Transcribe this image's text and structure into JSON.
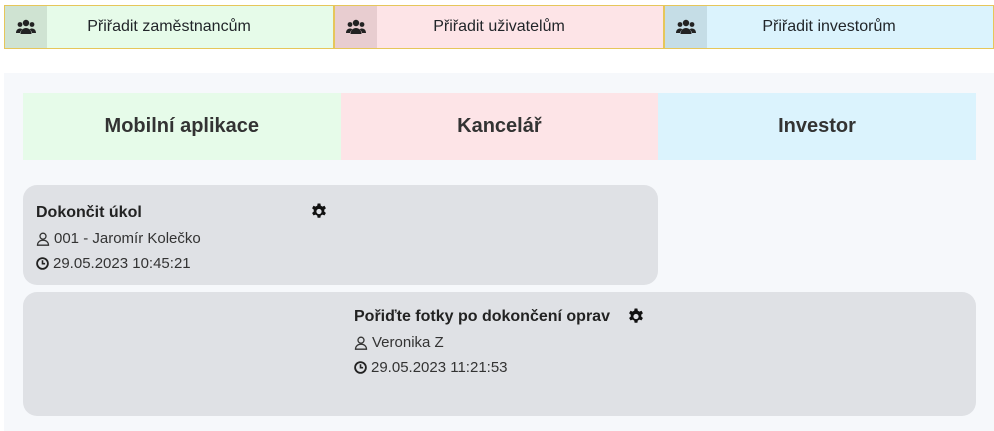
{
  "assign_buttons": [
    {
      "label": "Přiřadit zaměstnancům",
      "icon": "users-icon",
      "color": "#e6fbe9"
    },
    {
      "label": "Přiřadit uživatelům",
      "icon": "users-icon",
      "color": "#fde4e7"
    },
    {
      "label": "Přiřadit investorům",
      "icon": "users-icon",
      "color": "#dbf3fd"
    }
  ],
  "columns": [
    {
      "title": "Mobilní aplikace",
      "color": "#e6fbe9"
    },
    {
      "title": "Kancelář",
      "color": "#fde4e7"
    },
    {
      "title": "Investor",
      "color": "#dbf3fd"
    }
  ],
  "tasks": [
    {
      "title": "Dokončit úkol",
      "assignee": "001 - Jaromír Kolečko",
      "datetime": "29.05.2023 10:45:21",
      "user_icon": "user-outline-icon",
      "clock_icon": "clock-icon",
      "settings_icon": "gear-icon"
    },
    {
      "title": "Pořiďte fotky po dokončení oprav",
      "assignee": "Veronika Z",
      "datetime": "29.05.2023 11:21:53",
      "user_icon": "user-outline-icon",
      "clock_icon": "clock-icon",
      "settings_icon": "gear-icon"
    }
  ]
}
